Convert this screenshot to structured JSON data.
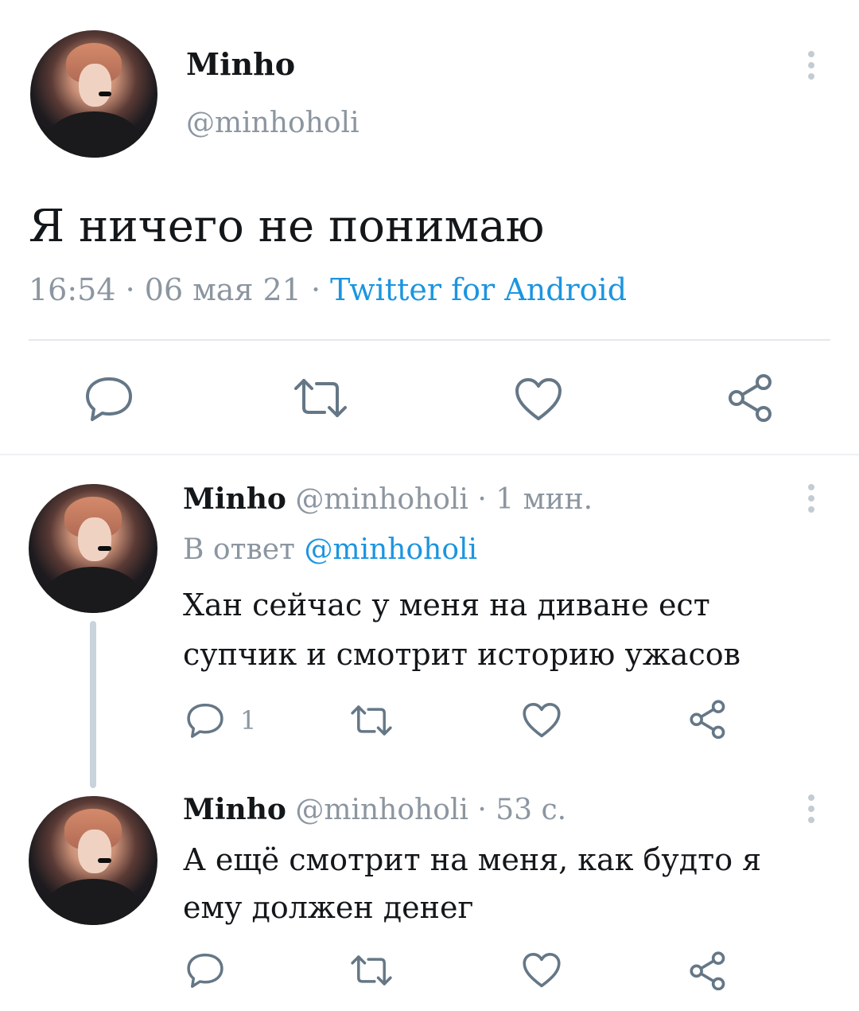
{
  "main_tweet": {
    "display_name": "Minho",
    "handle": "@minhoholi",
    "text": "Я ничего не понимаю",
    "time": "16:54",
    "date": "06 мая 21",
    "dot": "·",
    "client": "Twitter for Android"
  },
  "replies": [
    {
      "display_name": "Minho",
      "meta": "@minhoholi · 1 мин.",
      "reply_prefix": "В ответ",
      "reply_to": "@minhoholi",
      "text_line1": "Хан сейчас у меня на диване ест",
      "text_line2": "супчик и смотрит историю ужасов",
      "reply_count": "1"
    },
    {
      "display_name": "Minho",
      "meta": "@minhoholi · 53 с.",
      "text_line1": "А ещё смотрит на меня, как будто я",
      "text_line2": "ему должен денег"
    }
  ],
  "colors": {
    "accent": "#1b95e0",
    "muted": "#8c96a0",
    "icon": "#657786",
    "divider": "#e3e8ec"
  },
  "icons": [
    "reply-icon",
    "retweet-icon",
    "like-icon",
    "share-icon",
    "more-vertical-icon"
  ]
}
